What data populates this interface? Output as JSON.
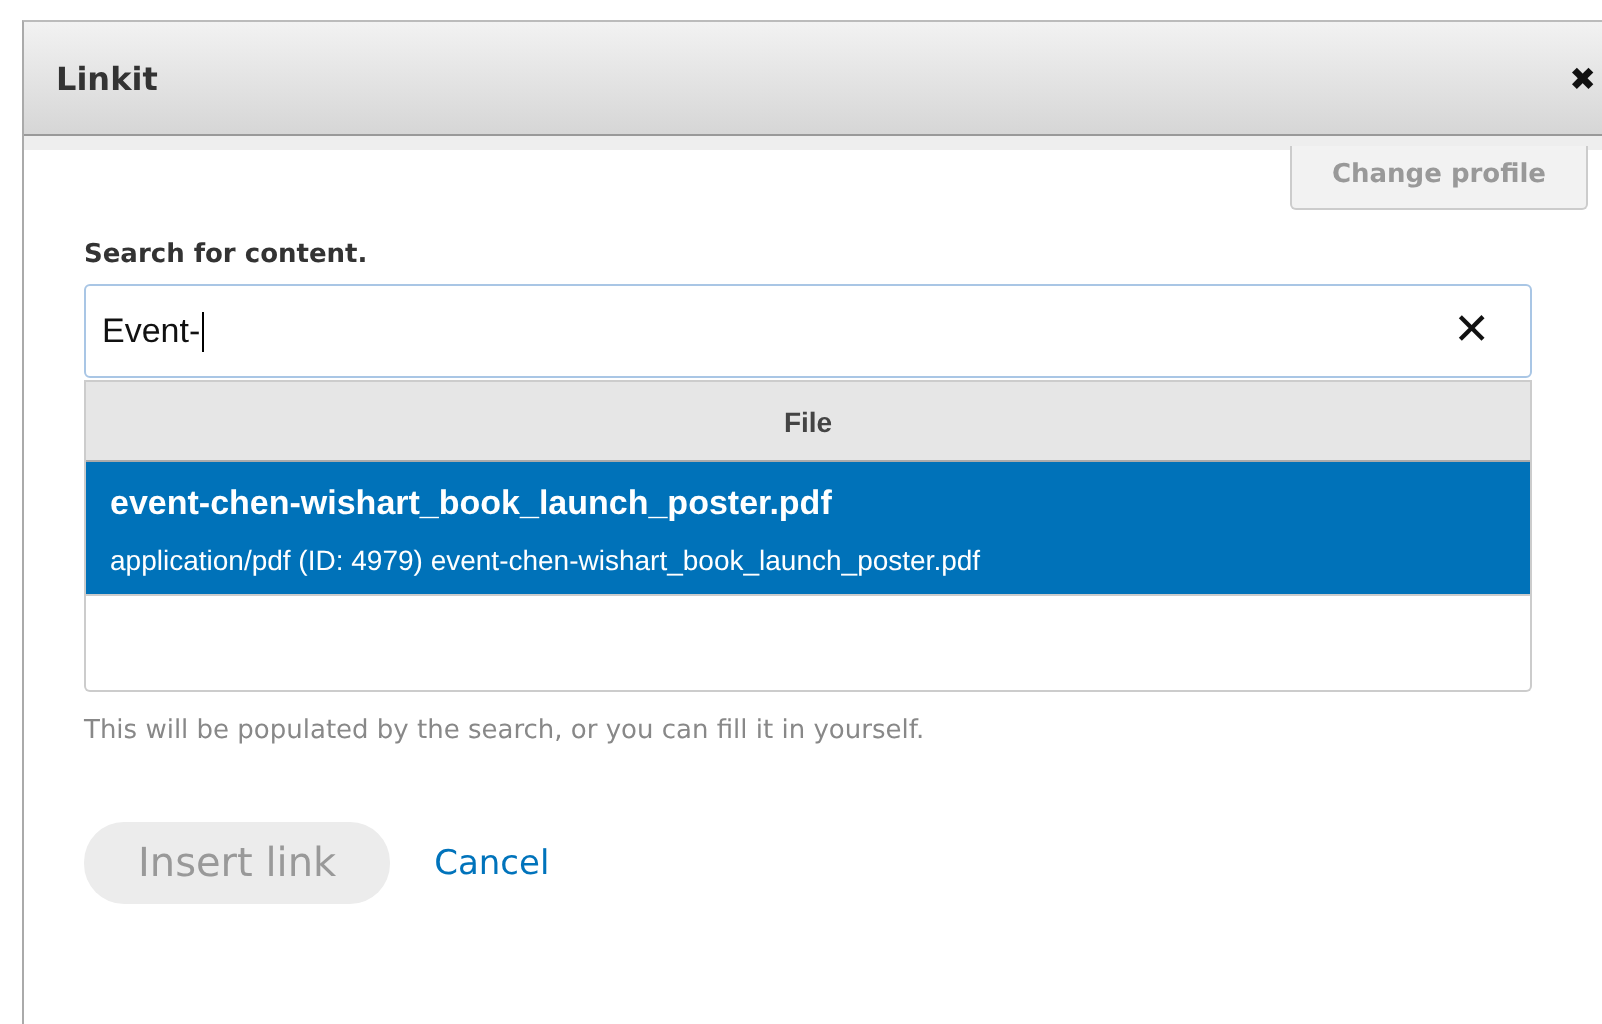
{
  "window": {
    "title": "Linkit",
    "close": "✖"
  },
  "change_profile": {
    "label": "Change profile",
    "disabled": true
  },
  "search": {
    "label": "Search for content.",
    "value": "Event-",
    "clear": "✕"
  },
  "results": {
    "header": "File",
    "items": [
      {
        "title": "event-chen-wishart_book_launch_poster.pdf",
        "description": "application/pdf (ID: 4979) event-chen-wishart_book_launch_poster.pdf",
        "selected": true
      }
    ]
  },
  "url_field": {
    "help": "This will be populated by the search, or you can fill it in yourself."
  },
  "actions": {
    "insert": {
      "label": "Insert link",
      "disabled": true
    },
    "cancel": "Cancel"
  }
}
